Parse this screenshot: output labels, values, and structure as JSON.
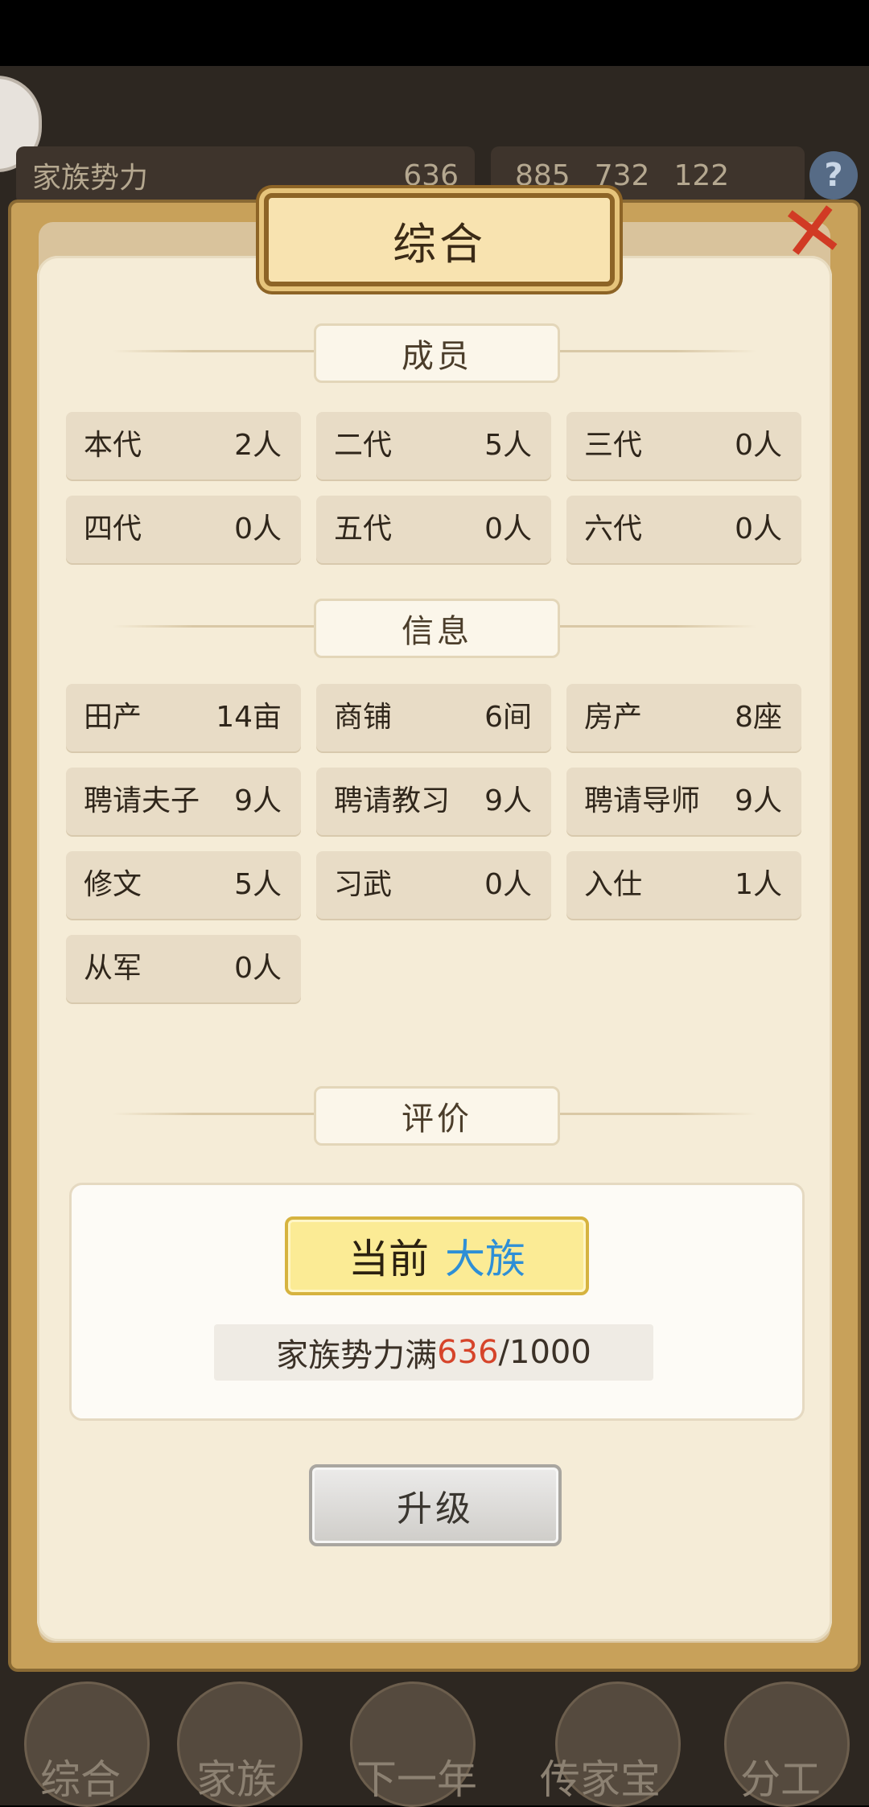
{
  "top_bar": {
    "power_label": "家族势力",
    "power_value": "636",
    "silver": "885",
    "iron": "732",
    "coin": "122",
    "help_icon": "question-icon"
  },
  "dialog": {
    "title": "综合",
    "close_icon": "close-icon",
    "members_header": "成员",
    "members": [
      {
        "label": "本代",
        "value": "2人"
      },
      {
        "label": "二代",
        "value": "5人"
      },
      {
        "label": "三代",
        "value": "0人"
      },
      {
        "label": "四代",
        "value": "0人"
      },
      {
        "label": "五代",
        "value": "0人"
      },
      {
        "label": "六代",
        "value": "0人"
      }
    ],
    "info_header": "信息",
    "info": [
      {
        "label": "田产",
        "value": "14亩"
      },
      {
        "label": "商铺",
        "value": "6间"
      },
      {
        "label": "房产",
        "value": "8座"
      },
      {
        "label": "聘请夫子",
        "value": "9人"
      },
      {
        "label": "聘请教习",
        "value": "9人"
      },
      {
        "label": "聘请导师",
        "value": "9人"
      },
      {
        "label": "修文",
        "value": "5人"
      },
      {
        "label": "习武",
        "value": "0人"
      },
      {
        "label": "入仕",
        "value": "1人"
      },
      {
        "label": "从军",
        "value": "0人"
      }
    ],
    "eval_header": "评价",
    "rank_prefix": "当前",
    "rank_value": "大族",
    "progress_prefix": "家族势力满",
    "progress_current": "636",
    "progress_total": "/1000",
    "progress_fraction": 0.636,
    "upgrade_label": "升级"
  },
  "bottom_nav": [
    {
      "label": "综合"
    },
    {
      "label": "家族"
    },
    {
      "label": "下一年"
    },
    {
      "label": "传家宝"
    },
    {
      "label": "分工"
    }
  ],
  "colors": {
    "rank_blue": "#2e8fd6",
    "progress_red": "#d6442a",
    "close_red": "#d13a24"
  }
}
